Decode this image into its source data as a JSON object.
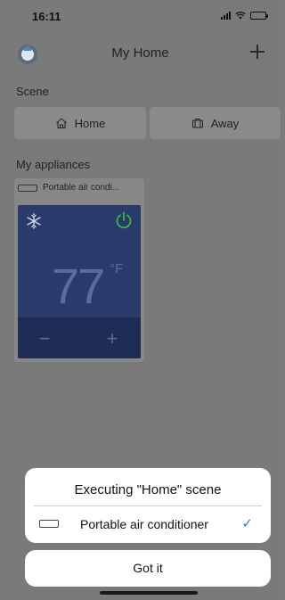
{
  "status_bar": {
    "time": "16:11",
    "icons": [
      "signal-icon",
      "wifi-icon",
      "battery-icon"
    ]
  },
  "header": {
    "title": "My Home",
    "add_icon": "plus-icon",
    "avatar_icon": "avatar-icon"
  },
  "scene": {
    "label": "Scene",
    "items": [
      {
        "label": "Home",
        "icon": "house-icon"
      },
      {
        "label": "Away",
        "icon": "suitcase-icon"
      }
    ]
  },
  "appliances": {
    "label": "My appliances",
    "items": [
      {
        "name": "Portable air condi...",
        "icon": "air-conditioner-icon",
        "mode_icon": "snowflake-icon",
        "power_icon": "power-icon",
        "temperature": "77",
        "unit": "°F",
        "decrease_label": "−",
        "increase_label": "+"
      }
    ]
  },
  "dialog": {
    "title": "Executing \"Home\" scene",
    "rows": [
      {
        "label": "Portable air conditioner",
        "icon": "air-conditioner-icon",
        "status_icon": "check-icon",
        "status_glyph": "✓"
      }
    ],
    "confirm_label": "Got it"
  },
  "colors": {
    "overlay_bg": "#7a7a7a",
    "ac_panel": "#2a3a6a",
    "power_on": "#3fb34a",
    "accent_check": "#2d7be0"
  }
}
